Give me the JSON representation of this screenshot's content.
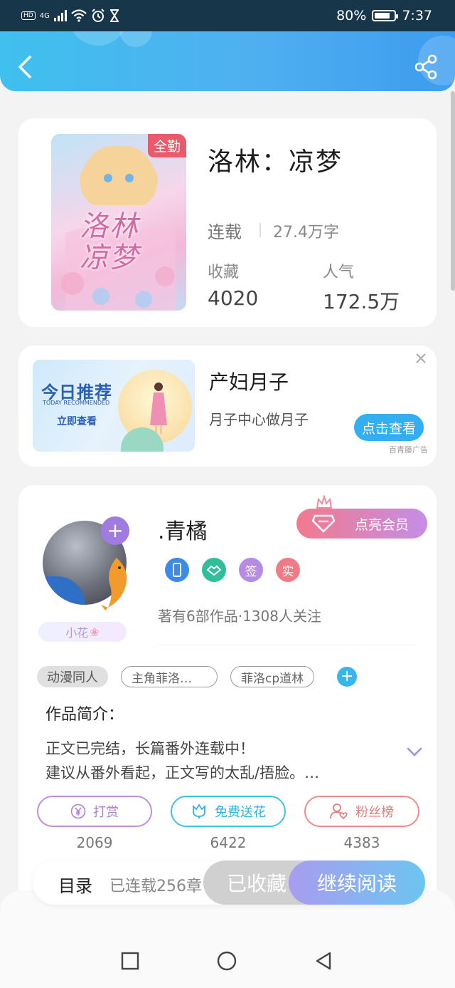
{
  "status_bar": {
    "network": "4G",
    "battery": "80%",
    "battery_level": 0.8,
    "time": "7:37"
  },
  "header": {
    "back_icon": "chevron-left-icon",
    "share_icon": "share-icon"
  },
  "book": {
    "badge": "全勤",
    "cover_art_text": "洛林凉梦",
    "title": "洛林：凉梦",
    "status": "连载",
    "word_count": "27.4万字",
    "favorites_label": "收藏",
    "favorites_value": "4020",
    "popularity_label": "人气",
    "popularity_value": "172.5万"
  },
  "ad": {
    "image_title": "今日推荐",
    "image_subtitle": "TODAY RECOMMENDED",
    "image_cta": "立即查看",
    "title": "产妇月子",
    "description": "月子中心做月子",
    "button": "点击查看",
    "source": "百青藤广告"
  },
  "author": {
    "name": ".青橘",
    "vip_button": "点亮会员",
    "flower_badge": "小花",
    "badges": [
      "签",
      "实"
    ],
    "stats": "著有6部作品·1308人关注",
    "tags": [
      "动漫同人",
      "主角菲洛…",
      "菲洛cp道林"
    ],
    "intro_title": "作品简介：",
    "intro_line1": "正文已完结，长篇番外连载中！",
    "intro_line2": "建议从番外看起，正文写的太乱/捂脸。…",
    "actions": [
      {
        "label": "打赏",
        "count": "2069"
      },
      {
        "label": "免费送花",
        "count": "6422"
      },
      {
        "label": "粉丝榜",
        "count": "4383"
      }
    ]
  },
  "bottom_bar": {
    "catalog": "目录",
    "chapters": "已连载256章",
    "collected": "已收藏",
    "continue_reading": "继续阅读"
  },
  "colors": {
    "header_start": "#3fc0ee",
    "header_end": "#3c9cef",
    "accent_blue": "#33aef0",
    "vip_start": "#f27a8d",
    "vip_end": "#c48ee6"
  }
}
